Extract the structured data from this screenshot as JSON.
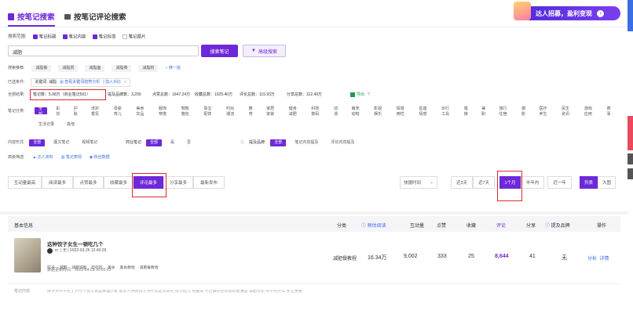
{
  "tabs": [
    {
      "label": "按笔记搜索",
      "icon": "document-icon",
      "active": true
    },
    {
      "label": "按笔记评论搜索",
      "icon": "comment-icon",
      "active": false
    }
  ],
  "banner": {
    "text": "达人招募，盈利变现",
    "arrow": "›"
  },
  "scope": {
    "label": "搜索范围:",
    "options": [
      {
        "label": "笔记标题",
        "checked": true
      },
      {
        "label": "笔记内容",
        "checked": true
      },
      {
        "label": "笔记标签",
        "checked": true
      },
      {
        "label": "笔记图片",
        "checked": false
      }
    ]
  },
  "search": {
    "value": "减脂",
    "button": "搜索笔记",
    "advanced": "高级搜索"
  },
  "recommend": {
    "label": "搜索推荐:",
    "items": [
      "减脂餐",
      "减脂粥",
      "减脂面",
      "减脂菜",
      "减脂粉"
    ],
    "refresh": "换一批"
  },
  "conditions": {
    "label": "已选条件:",
    "keyword_label": "关键词: 减脂",
    "keyword_link": "查看关键词趋势分析",
    "compare": "加入对比"
  },
  "results": {
    "label": "全部结果:",
    "count": "笔记数：5.98万（商业笔记501）",
    "brands": "提及品牌数：3,200",
    "likes": "点赞总数：1647.24万",
    "collects": "收藏总数：1025.40万",
    "comments": "评论总数：115.93万",
    "shares": "分享总数：112.49万",
    "export": "导出",
    "help": "?"
  },
  "category": {
    "label": "笔记分类:",
    "items": [
      "全部",
      "彩妆",
      "护肤",
      "洗护香氛",
      "母婴育儿",
      "美食饮品",
      "服饰穿搭",
      "鞋靴箱包",
      "珠宝配饰",
      "时尚潮流",
      "教育",
      "家居家装",
      "健身减肥",
      "科技数码",
      "动漫",
      "萌宠动物",
      "影视娱乐",
      "情感两性",
      "星座情感",
      "出行工具",
      "婚嫁",
      "兼职",
      "旅行住宿",
      "摄影",
      "医疗养生",
      "民生资讯",
      "游戏应用",
      "赛事",
      "生活记录",
      "其他"
    ]
  },
  "content_type": {
    "label": "内容形式:",
    "items": [
      "全部",
      "图文笔记",
      "视频笔记"
    ],
    "commercial_label": "商业笔记",
    "commercial": [
      "全部",
      "是",
      "否"
    ],
    "brand_label": "提及品牌:",
    "brand": [
      "全部",
      "笔记内容提及",
      "评论内容提及"
    ]
  },
  "advanced_filter": {
    "label": "高级筛选:",
    "items": [
      "达人资料",
      "笔记表现",
      "粉丝数据"
    ]
  },
  "sort": {
    "items": [
      "互动量最高",
      "阅读最多",
      "点赞最多",
      "收藏最多",
      "评论最多",
      "分享最多",
      "最新发布"
    ],
    "active": "评论最多",
    "time_select": "快捷时间",
    "ranges": [
      "近3天",
      "近7天",
      "1个月",
      "半年内",
      "近一年"
    ],
    "active_range": "1个月",
    "view": [
      "列表",
      "大图"
    ]
  },
  "table": {
    "header": "基本信息",
    "columns": [
      "分类",
      "预估阅读",
      "互动量",
      "点赞",
      "收藏",
      "评论",
      "分享",
      "提及品牌",
      "操作"
    ],
    "row": {
      "title": "这种饺子女生一顿吃几个",
      "author": "cr",
      "author_extra": "| 无 | 2022-03-26 12:40:26",
      "tags": [
        "饺子",
        "减肥",
        "减肥减脂",
        "吃吃吃",
        "美食",
        "美食教程",
        "减肥餐教程"
      ],
      "updated": "数据更新时间：2022-04-03 19:03:03",
      "category": "减肥餐教程",
      "reads": "16.34万",
      "interactions": "9,002",
      "likes": "333",
      "collects": "25",
      "comments": "8,644",
      "shares": "41",
      "brand": "无",
      "actions": [
        "分析",
        "详情"
      ]
    }
  },
  "footer": {
    "label": "笔记内容",
    "text": "除今天中午吃了六七个饺子真是幸福小雀 很多人问我饺子为什么这么好吃 饺子馅儿 热量高 不过偶尔吃点真的很满足 减肥日记 中午吃什么 女生食量"
  },
  "colors": {
    "accent": "#6d28d9",
    "highlight": "#e0282e"
  }
}
